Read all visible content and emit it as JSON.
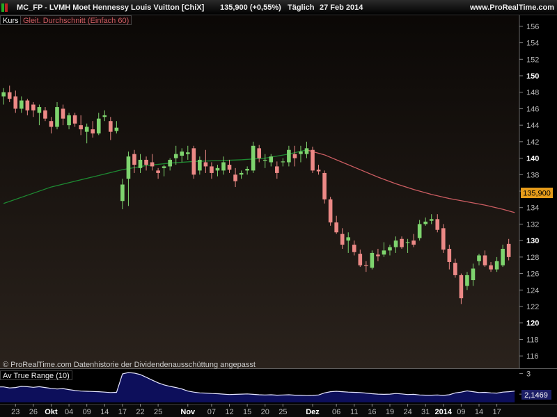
{
  "header": {
    "symbol": "MC_FP - LVMH Moet Hennessy Louis Vuitton [ChiX]",
    "price": "135,900 (+0,55%)",
    "period": "Täglich",
    "date": "27 Feb 2014",
    "site": "www.ProRealTime.com"
  },
  "main_legend": {
    "kurs": "Kurs",
    "ma": "Gleit. Durchschnitt (Einfach 60)"
  },
  "copyright": "© ProRealTime.com  Datenhistorie der Dividendenausschüttung angepasst",
  "current_price_label": "135,900",
  "atr_legend": "Av True Range (10)",
  "atr_value_label": "2,1469",
  "colors": {
    "up": "#7ed46e",
    "down": "#ec8986",
    "ma_up": "#1d8a32",
    "ma_down": "#cc5d62",
    "atr_line": "#e6e6ff",
    "atr_fill": "#0e1060",
    "bg_top": "#0b0806",
    "bg_bottom": "#2a221c"
  },
  "chart_data": [
    {
      "type": "candlestick",
      "title": "MC_FP - LVMH Moet Hennessy Louis Vuitton [ChiX]",
      "ylim": [
        115,
        157
      ],
      "y_ticks": [
        116,
        118,
        120,
        122,
        124,
        126,
        128,
        130,
        132,
        134,
        136,
        138,
        140,
        142,
        144,
        146,
        148,
        150,
        152,
        154,
        156
      ],
      "y_ticks_bold": [
        120,
        130,
        140,
        150
      ],
      "x_ticks": [
        {
          "index": 2,
          "label": "23",
          "bold": false
        },
        {
          "index": 5,
          "label": "26",
          "bold": false
        },
        {
          "index": 8,
          "label": "Okt",
          "bold": true
        },
        {
          "index": 11,
          "label": "04",
          "bold": false
        },
        {
          "index": 14,
          "label": "09",
          "bold": false
        },
        {
          "index": 17,
          "label": "14",
          "bold": false
        },
        {
          "index": 20,
          "label": "17",
          "bold": false
        },
        {
          "index": 23,
          "label": "22",
          "bold": false
        },
        {
          "index": 26,
          "label": "25",
          "bold": false
        },
        {
          "index": 31,
          "label": "Nov",
          "bold": true
        },
        {
          "index": 35,
          "label": "07",
          "bold": false
        },
        {
          "index": 38,
          "label": "12",
          "bold": false
        },
        {
          "index": 41,
          "label": "15",
          "bold": false
        },
        {
          "index": 44,
          "label": "20",
          "bold": false
        },
        {
          "index": 47,
          "label": "25",
          "bold": false
        },
        {
          "index": 52,
          "label": "Dez",
          "bold": true
        },
        {
          "index": 56,
          "label": "06",
          "bold": false
        },
        {
          "index": 59,
          "label": "11",
          "bold": false
        },
        {
          "index": 62,
          "label": "16",
          "bold": false
        },
        {
          "index": 65,
          "label": "19",
          "bold": false
        },
        {
          "index": 68,
          "label": "24",
          "bold": false
        },
        {
          "index": 71,
          "label": "31",
          "bold": false
        },
        {
          "index": 74,
          "label": "2014",
          "bold": true
        },
        {
          "index": 77,
          "label": "09",
          "bold": false
        },
        {
          "index": 80,
          "label": "14",
          "bold": false
        },
        {
          "index": 83,
          "label": "17",
          "bold": false
        }
      ],
      "ohlc": [
        [
          147.5,
          148.5,
          146.5,
          148.0
        ],
        [
          148.0,
          148.8,
          146.8,
          147.2
        ],
        [
          147.5,
          148.2,
          145.5,
          146.0
        ],
        [
          146.0,
          147.5,
          145.5,
          147.0
        ],
        [
          147.0,
          147.2,
          145.2,
          145.8
        ],
        [
          146.5,
          146.8,
          145.0,
          145.8
        ],
        [
          145.5,
          146.5,
          144.0,
          146.2
        ],
        [
          145.8,
          146.2,
          144.5,
          144.8
        ],
        [
          144.5,
          145.0,
          143.0,
          143.8
        ],
        [
          143.8,
          146.8,
          143.5,
          146.2
        ],
        [
          146.0,
          146.5,
          144.0,
          144.8
        ],
        [
          144.0,
          145.5,
          143.5,
          145.2
        ],
        [
          145.2,
          145.5,
          143.8,
          144.2
        ],
        [
          144.0,
          145.2,
          142.8,
          143.5
        ],
        [
          143.2,
          144.2,
          141.8,
          143.8
        ],
        [
          143.5,
          144.5,
          142.5,
          143.0
        ],
        [
          143.0,
          145.5,
          142.8,
          144.8
        ],
        [
          145.0,
          145.8,
          144.5,
          145.2
        ],
        [
          144.5,
          145.0,
          142.2,
          143.2
        ],
        [
          143.3,
          144.5,
          143.0,
          143.7
        ],
        [
          134.8,
          137.5,
          133.8,
          136.8
        ],
        [
          137.5,
          140.8,
          134.2,
          140.2
        ],
        [
          140.5,
          141.0,
          138.2,
          139.2
        ],
        [
          138.8,
          140.5,
          138.2,
          139.8
        ],
        [
          139.8,
          140.2,
          138.5,
          139.2
        ],
        [
          139.5,
          140.5,
          138.5,
          139.0
        ],
        [
          138.5,
          138.8,
          137.5,
          138.2
        ],
        [
          138.8,
          139.2,
          137.8,
          139.0
        ],
        [
          139.0,
          140.0,
          138.5,
          139.8
        ],
        [
          140.0,
          141.5,
          139.2,
          140.5
        ],
        [
          140.3,
          141.2,
          139.5,
          140.8
        ],
        [
          140.5,
          141.5,
          139.8,
          140.7
        ],
        [
          141.2,
          141.5,
          137.5,
          138.0
        ],
        [
          138.5,
          140.2,
          138.0,
          139.8
        ],
        [
          139.5,
          141.0,
          138.2,
          139.0
        ],
        [
          139.0,
          139.5,
          137.5,
          138.2
        ],
        [
          138.5,
          139.2,
          137.8,
          138.8
        ],
        [
          138.5,
          140.2,
          138.0,
          139.5
        ],
        [
          139.2,
          139.8,
          138.2,
          138.6
        ],
        [
          138.0,
          138.8,
          136.5,
          137.2
        ],
        [
          138.0,
          138.5,
          137.5,
          138.2
        ],
        [
          138.5,
          139.0,
          138.0,
          138.7
        ],
        [
          138.5,
          142.0,
          138.2,
          141.5
        ],
        [
          141.2,
          141.6,
          139.5,
          140.0
        ],
        [
          139.8,
          140.5,
          138.8,
          139.8
        ],
        [
          139.5,
          140.5,
          139.0,
          140.2
        ],
        [
          139.0,
          139.6,
          137.5,
          138.2
        ],
        [
          139.5,
          140.0,
          139.0,
          139.6
        ],
        [
          139.5,
          141.5,
          139.0,
          141.0
        ],
        [
          140.5,
          141.5,
          139.0,
          140.0
        ],
        [
          140.5,
          141.5,
          139.5,
          140.8
        ],
        [
          140.5,
          142.0,
          140.0,
          141.2
        ],
        [
          141.0,
          141.4,
          138.2,
          138.5
        ],
        [
          138.6,
          139.2,
          138.0,
          138.4
        ],
        [
          138.2,
          138.5,
          134.5,
          135.0
        ],
        [
          135.0,
          135.3,
          131.8,
          132.2
        ],
        [
          132.2,
          133.0,
          130.8,
          131.0
        ],
        [
          130.8,
          131.5,
          129.0,
          129.5
        ],
        [
          130.0,
          131.0,
          128.5,
          130.4
        ],
        [
          129.5,
          130.0,
          128.2,
          128.6
        ],
        [
          128.4,
          128.9,
          126.8,
          127.0
        ],
        [
          127.0,
          127.5,
          126.2,
          126.9
        ],
        [
          126.7,
          128.8,
          126.5,
          128.5
        ],
        [
          128.3,
          129.0,
          127.5,
          128.1
        ],
        [
          128.3,
          129.8,
          128.0,
          128.8
        ],
        [
          128.8,
          129.5,
          128.2,
          129.2
        ],
        [
          129.2,
          130.5,
          128.5,
          130.0
        ],
        [
          130.2,
          130.5,
          129.0,
          129.2
        ],
        [
          129.8,
          130.2,
          128.5,
          129.8
        ],
        [
          130.0,
          130.8,
          129.2,
          129.5
        ],
        [
          130.3,
          132.5,
          130.0,
          132.0
        ],
        [
          132.0,
          132.8,
          131.8,
          132.3
        ],
        [
          132.4,
          133.2,
          132.0,
          132.6
        ],
        [
          132.6,
          133.2,
          131.0,
          131.3
        ],
        [
          131.5,
          132.0,
          128.5,
          128.9
        ],
        [
          129.0,
          129.5,
          126.5,
          127.4
        ],
        [
          127.3,
          127.8,
          125.5,
          125.8
        ],
        [
          125.8,
          126.0,
          122.3,
          123.0
        ],
        [
          124.5,
          126.2,
          124.0,
          125.8
        ],
        [
          125.2,
          127.2,
          124.5,
          126.6
        ],
        [
          127.5,
          128.4,
          127.0,
          128.2
        ],
        [
          128.2,
          128.8,
          126.8,
          127.0
        ],
        [
          127.0,
          127.4,
          126.2,
          126.5
        ],
        [
          126.5,
          128.0,
          126.2,
          127.5
        ],
        [
          127.0,
          129.5,
          126.8,
          129.0
        ],
        [
          129.6,
          130.2,
          127.6,
          128.0
        ]
      ],
      "sma60": [
        [
          0,
          134.5
        ],
        [
          4,
          135.5
        ],
        [
          8,
          136.5
        ],
        [
          12,
          137.2
        ],
        [
          16,
          137.9
        ],
        [
          20,
          138.6
        ],
        [
          24,
          139.1
        ],
        [
          28,
          139.4
        ],
        [
          32,
          139.6
        ],
        [
          36,
          139.7
        ],
        [
          40,
          139.8
        ],
        [
          44,
          140.0
        ],
        [
          48,
          140.5
        ],
        [
          51,
          141.0
        ],
        [
          54,
          140.4
        ],
        [
          57,
          139.5
        ],
        [
          60,
          138.6
        ],
        [
          63,
          137.7
        ],
        [
          66,
          136.9
        ],
        [
          69,
          136.2
        ],
        [
          72,
          135.6
        ],
        [
          75,
          135.1
        ],
        [
          78,
          134.7
        ],
        [
          81,
          134.3
        ],
        [
          84,
          133.8
        ],
        [
          86,
          133.4
        ]
      ]
    },
    {
      "type": "line",
      "title": "Av True Range (10)",
      "ylim": [
        1.6,
        3.15
      ],
      "y_ticks": [
        2,
        3
      ],
      "values": [
        2.35,
        2.3,
        2.32,
        2.38,
        2.36,
        2.33,
        2.36,
        2.32,
        2.28,
        2.25,
        2.27,
        2.22,
        2.18,
        2.15,
        2.14,
        2.13,
        2.12,
        2.1,
        2.08,
        2.09,
        2.98,
        3.05,
        3.02,
        2.95,
        2.82,
        2.68,
        2.55,
        2.45,
        2.38,
        2.32,
        2.25,
        2.15,
        2.1,
        2.06,
        2.05,
        2.03,
        2.02,
        2.0,
        1.98,
        1.99,
        2.0,
        2.01,
        1.99,
        1.97,
        1.96,
        1.97,
        1.95,
        1.96,
        1.97,
        1.95,
        1.95,
        1.93,
        1.94,
        1.96,
        2.06,
        2.12,
        2.14,
        2.12,
        2.1,
        2.09,
        2.08,
        2.05,
        2.02,
        2.0,
        1.99,
        2.0,
        2.03,
        2.01,
        1.98,
        1.99,
        1.96,
        1.95,
        1.95,
        1.96,
        1.94,
        1.97,
        2.06,
        2.1,
        2.16,
        2.12,
        2.08,
        2.09,
        2.06,
        2.05,
        2.1,
        2.12,
        2.15
      ]
    }
  ]
}
